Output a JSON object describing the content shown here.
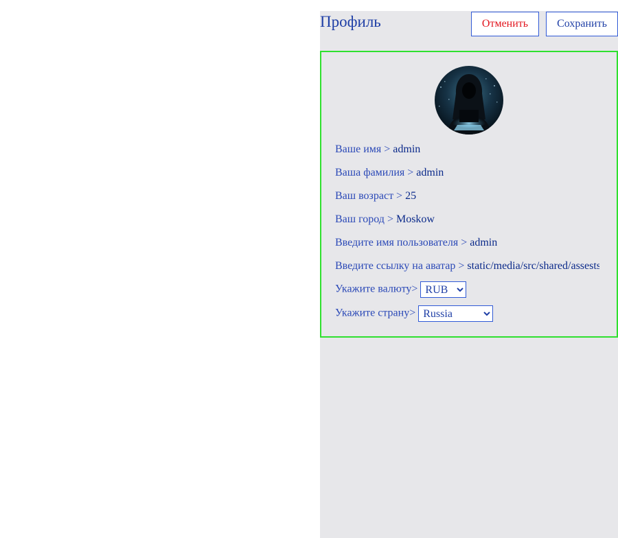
{
  "header": {
    "title": "Профиль",
    "cancel_label": "Отменить",
    "save_label": "Сохранить"
  },
  "profile": {
    "avatar_icon": "hooded-hacker-avatar",
    "fields": [
      {
        "label": "Ваше имя > ",
        "value": "admin"
      },
      {
        "label": "Ваша фамилия > ",
        "value": "admin"
      },
      {
        "label": "Ваш возраст > ",
        "value": "25"
      },
      {
        "label": "Ваш город > ",
        "value": "Moskow"
      },
      {
        "label": "Введите имя пользователя > ",
        "value": "admin"
      },
      {
        "label": "Введите ссылку на аватар > ",
        "value": "static/media/src/shared/assests"
      }
    ],
    "currency": {
      "label": "Укажите валюту>",
      "selected": "RUB"
    },
    "country": {
      "label": "Укажите страну>",
      "selected": "Russia"
    }
  },
  "colors": {
    "panel_bg": "#e7e7ea",
    "card_border": "#2ee02e",
    "primary_text": "#1f3fa6",
    "cancel_text": "#e2161f",
    "button_border": "#2f59d6"
  }
}
